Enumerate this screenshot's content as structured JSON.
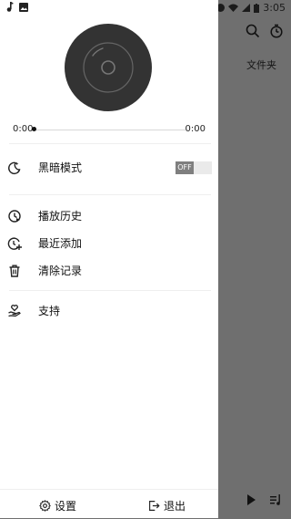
{
  "status_bar": {
    "time": "3:05"
  },
  "player": {
    "elapsed": "0:00",
    "total": "0:00"
  },
  "menu": {
    "dark_mode_label": "黑暗模式",
    "dark_mode_state": "OFF",
    "items": [
      {
        "label": "播放历史",
        "icon": "history-icon"
      },
      {
        "label": "最近添加",
        "icon": "recent-add-icon"
      },
      {
        "label": "清除记录",
        "icon": "trash-icon"
      },
      {
        "label": "支持",
        "icon": "support-hand-heart-icon"
      }
    ]
  },
  "bottom": {
    "settings_label": "设置",
    "exit_label": "退出"
  },
  "background_app": {
    "folder_label": "文件夹"
  },
  "colors": {
    "drawer_bg": "#ffffff",
    "scrim": "#6f6f6f",
    "disc": "#333333",
    "toggle_off": "#7f7f7f"
  }
}
